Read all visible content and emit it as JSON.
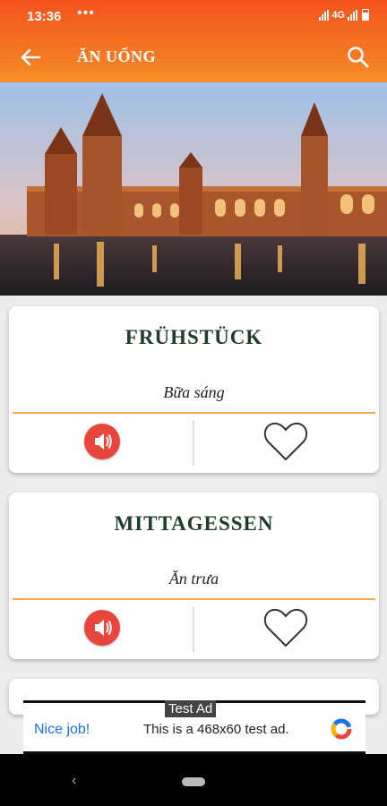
{
  "status_bar": {
    "time": "13:36",
    "dots": "•••",
    "network": "4G"
  },
  "app_bar": {
    "title": "ĂN UỐNG"
  },
  "cards": [
    {
      "word": "FRÜHSTÜCK",
      "meaning": "Bữa sáng"
    },
    {
      "word": "MITTAGESSEN",
      "meaning": "Ăn trưa"
    }
  ],
  "ad": {
    "badge": "Test Ad",
    "headline": "Nice job!",
    "description": "This is a 468x60 test ad."
  },
  "nav": {
    "back_glyph": "‹"
  },
  "colors": {
    "accent": "#f4541c",
    "accent_light": "#f7902a",
    "word_color": "#1f3d2a",
    "divider": "#f5a64a",
    "sound_button": "#e8453c"
  },
  "icons": [
    "back-arrow-icon",
    "search-icon",
    "speaker-icon",
    "heart-outline-icon",
    "adchoices-icon"
  ]
}
